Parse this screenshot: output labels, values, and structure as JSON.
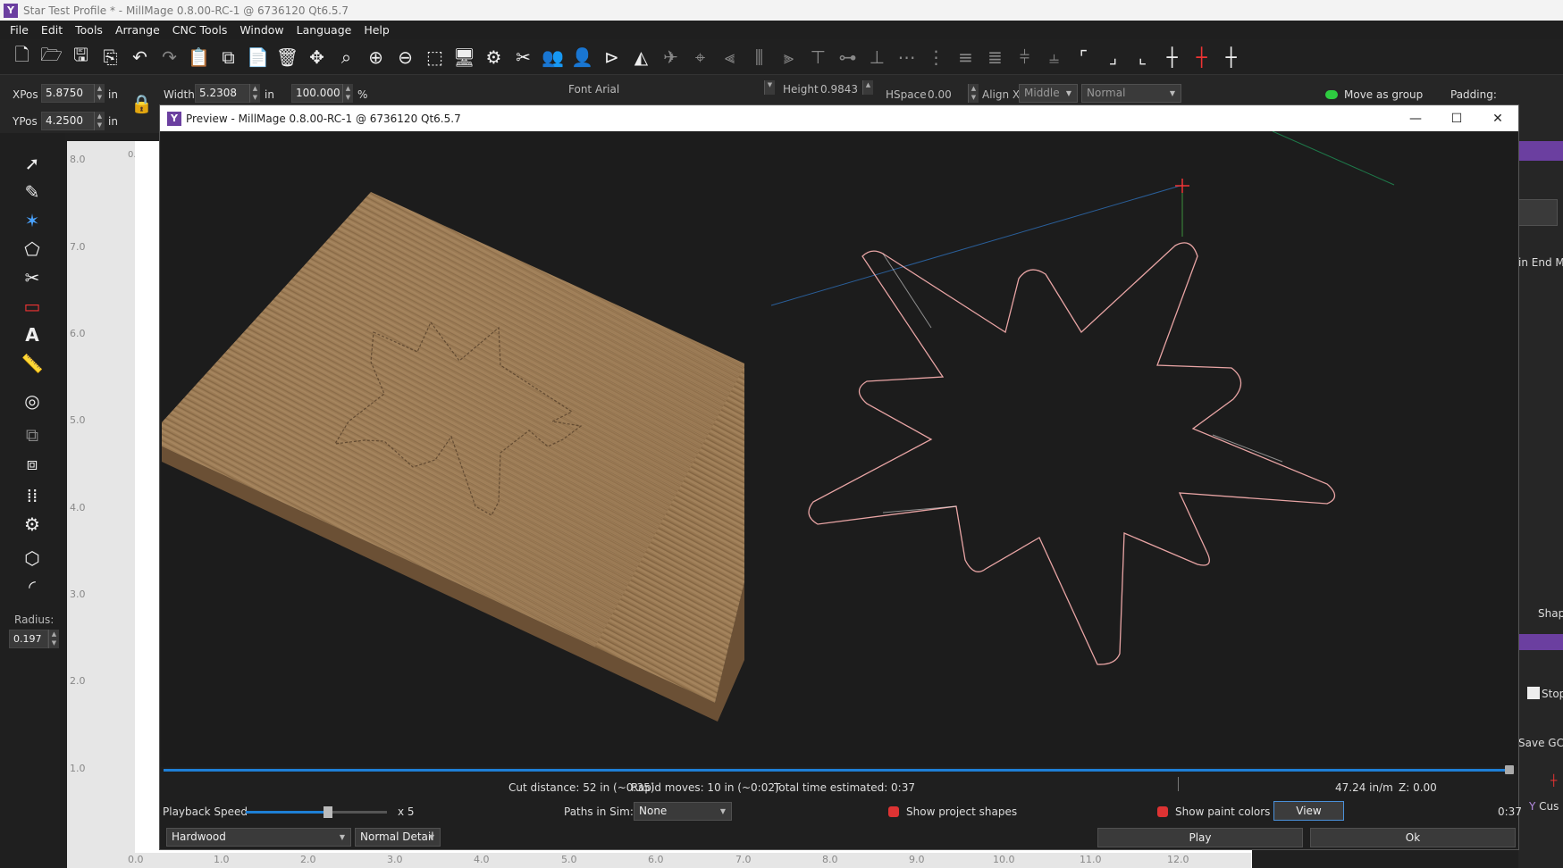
{
  "app": {
    "title": "Star Test Profile * - MillMage 0.8.00-RC-1 @ 6736120 Qt6.5.7"
  },
  "menu": [
    "File",
    "Edit",
    "Tools",
    "Arrange",
    "CNC Tools",
    "Window",
    "Language",
    "Help"
  ],
  "props": {
    "xpos_label": "XPos",
    "xpos_value": "5.8750",
    "xpos_unit": "in",
    "ypos_label": "YPos",
    "ypos_value": "4.2500",
    "ypos_unit": "in",
    "width_label": "Width",
    "width_value": "5.2308",
    "width_unit": "in",
    "scale_value": "100.000",
    "scale_unit": "%",
    "font_label": "Font",
    "font_value": "Arial",
    "height_label": "Height",
    "height_value": "0.9843",
    "hspace_label": "HSpace",
    "hspace_value": "0.00",
    "alignx_label": "Align X",
    "alignx_value": "Middle",
    "style_value": "Normal",
    "move_group_label": "Move as group",
    "padding_label": "Padding:"
  },
  "left_tools": {
    "radius_label": "Radius:",
    "radius_value": "0.197"
  },
  "ruler": {
    "v_ticks": [
      "8.0",
      "7.0",
      "6.0",
      "5.0",
      "4.0",
      "3.0",
      "2.0",
      "1.0"
    ],
    "h_ticks": [
      "0.0",
      "1.0",
      "2.0",
      "3.0",
      "4.0",
      "5.0",
      "6.0",
      "7.0",
      "8.0",
      "9.0",
      "10.0",
      "11.0",
      "12.0"
    ],
    "top_tick": "0.0"
  },
  "right_panel": {
    "end_label": "in End Mi",
    "shape_label": "Shap",
    "stop_label": "Stop",
    "save_label": "Save GCod",
    "cus_label": "Cus"
  },
  "preview": {
    "title": "Preview - MillMage 0.8.00-RC-1 @ 6736120 Qt6.5.7",
    "cut_distance": "Cut distance: 52 in (~0:35)",
    "rapid_moves": "Rapid moves: 10 in (~0:02)",
    "total_time": "Total time estimated: 0:37",
    "speed": "47.24 in/m",
    "z": "Z: 0.00",
    "elapsed": "0:37",
    "playback_label": "Playback Speed",
    "playback_multiplier": "x 5",
    "playback_level": 0.58,
    "paths_label": "Paths in Sim:",
    "paths_value": "None",
    "show_project_shapes": "Show project shapes",
    "show_paint_colors": "Show paint colors",
    "view_button": "View",
    "material_value": "Hardwood",
    "detail_value": "Normal Detail",
    "play_button": "Play",
    "ok_button": "Ok"
  },
  "colors": {
    "accent_blue": "#1e7fd6",
    "toolpath_pink": "#e8a4a4",
    "wood": "#9b7a55",
    "purple": "#6b3fa0"
  }
}
